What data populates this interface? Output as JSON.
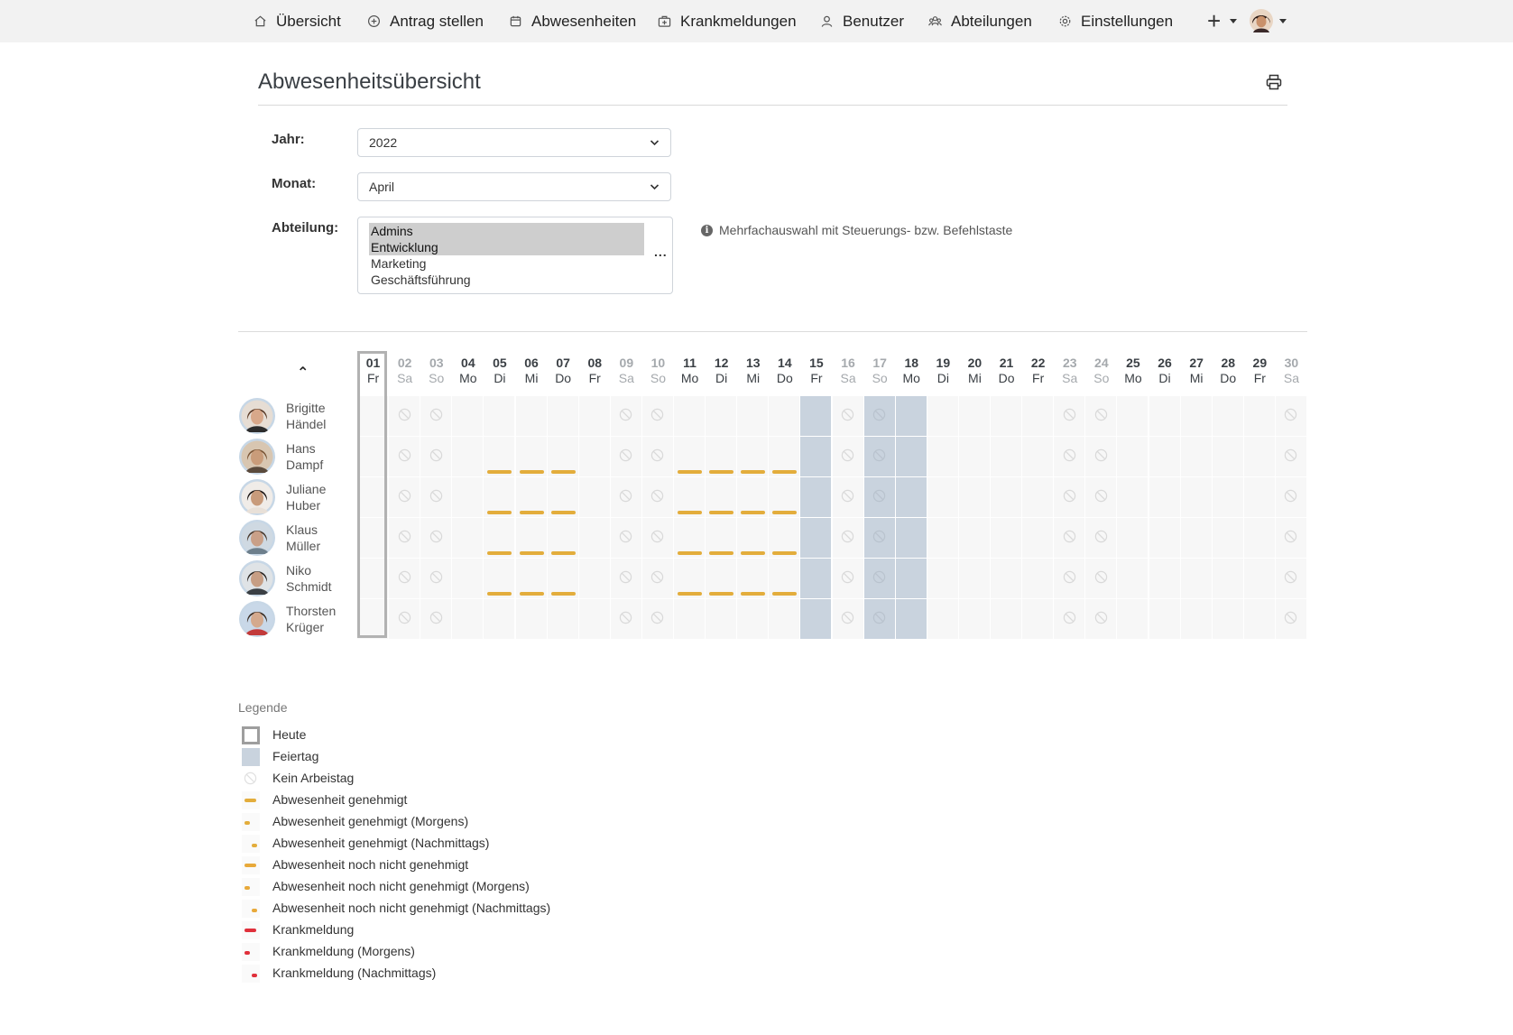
{
  "navbar": {
    "items": [
      {
        "label": "Übersicht",
        "icon": "home-icon"
      },
      {
        "label": "Antrag stellen",
        "icon": "plus-circle-icon"
      },
      {
        "label": "Abwesenheiten",
        "icon": "calendar-icon"
      },
      {
        "label": "Krankmeldungen",
        "icon": "medical-bag-icon"
      },
      {
        "label": "Benutzer",
        "icon": "user-icon"
      },
      {
        "label": "Abteilungen",
        "icon": "users-icon"
      },
      {
        "label": "Einstellungen",
        "icon": "gear-icon"
      }
    ],
    "add_symbol": "+"
  },
  "page": {
    "title": "Abwesenheitsübersicht"
  },
  "filters": {
    "year_label": "Jahr:",
    "year_value": "2022",
    "month_label": "Monat:",
    "month_value": "April",
    "department_label": "Abteilung:",
    "departments": [
      {
        "name": "Admins",
        "selected": true
      },
      {
        "name": "Entwicklung",
        "selected": true
      },
      {
        "name": "Marketing",
        "selected": false
      },
      {
        "name": "Geschäftsführung",
        "selected": false
      }
    ],
    "more_symbol": "...",
    "multi_hint": "Mehrfachauswahl mit Steuerungs- bzw. Befehlstaste"
  },
  "calendar": {
    "sort_symbol": "⌃",
    "today_day": "01",
    "days": [
      {
        "num": "01",
        "wd": "Fr",
        "type": "work"
      },
      {
        "num": "02",
        "wd": "Sa",
        "type": "weekend"
      },
      {
        "num": "03",
        "wd": "So",
        "type": "weekend"
      },
      {
        "num": "04",
        "wd": "Mo",
        "type": "work"
      },
      {
        "num": "05",
        "wd": "Di",
        "type": "work"
      },
      {
        "num": "06",
        "wd": "Mi",
        "type": "work"
      },
      {
        "num": "07",
        "wd": "Do",
        "type": "work"
      },
      {
        "num": "08",
        "wd": "Fr",
        "type": "work"
      },
      {
        "num": "09",
        "wd": "Sa",
        "type": "weekend"
      },
      {
        "num": "10",
        "wd": "So",
        "type": "weekend"
      },
      {
        "num": "11",
        "wd": "Mo",
        "type": "work"
      },
      {
        "num": "12",
        "wd": "Di",
        "type": "work"
      },
      {
        "num": "13",
        "wd": "Mi",
        "type": "work"
      },
      {
        "num": "14",
        "wd": "Do",
        "type": "work"
      },
      {
        "num": "15",
        "wd": "Fr",
        "type": "holiday"
      },
      {
        "num": "16",
        "wd": "Sa",
        "type": "weekend"
      },
      {
        "num": "17",
        "wd": "So",
        "type": "holiday-weekend"
      },
      {
        "num": "18",
        "wd": "Mo",
        "type": "holiday"
      },
      {
        "num": "19",
        "wd": "Di",
        "type": "work"
      },
      {
        "num": "20",
        "wd": "Mi",
        "type": "work"
      },
      {
        "num": "21",
        "wd": "Do",
        "type": "work"
      },
      {
        "num": "22",
        "wd": "Fr",
        "type": "work"
      },
      {
        "num": "23",
        "wd": "Sa",
        "type": "weekend"
      },
      {
        "num": "24",
        "wd": "So",
        "type": "weekend"
      },
      {
        "num": "25",
        "wd": "Mo",
        "type": "work"
      },
      {
        "num": "26",
        "wd": "Di",
        "type": "work"
      },
      {
        "num": "27",
        "wd": "Mi",
        "type": "work"
      },
      {
        "num": "28",
        "wd": "Do",
        "type": "work"
      },
      {
        "num": "29",
        "wd": "Fr",
        "type": "work"
      },
      {
        "num": "30",
        "wd": "Sa",
        "type": "weekend"
      }
    ],
    "people": [
      {
        "first": "Brigitte",
        "last": "Händel",
        "absence_days": []
      },
      {
        "first": "Hans",
        "last": "Dampf",
        "absence_days": [
          5,
          6,
          7,
          11,
          12,
          13,
          14
        ]
      },
      {
        "first": "Juliane",
        "last": "Huber",
        "absence_days": [
          5,
          6,
          7,
          11,
          12,
          13,
          14
        ]
      },
      {
        "first": "Klaus",
        "last": "Müller",
        "absence_days": [
          5,
          6,
          7,
          11,
          12,
          13,
          14
        ]
      },
      {
        "first": "Niko",
        "last": "Schmidt",
        "absence_days": [
          5,
          6,
          7,
          11,
          12,
          13,
          14
        ]
      },
      {
        "first": "Thorsten",
        "last": "Krüger",
        "absence_days": []
      }
    ]
  },
  "legend": {
    "title": "Legende",
    "items": [
      {
        "label": "Heute",
        "kind": "today"
      },
      {
        "label": "Feiertag",
        "kind": "holiday"
      },
      {
        "label": "Kein Arbeistag",
        "kind": "nowork"
      },
      {
        "label": "Abwesenheit genehmigt",
        "kind": "full",
        "color": "#e3ad3c"
      },
      {
        "label": "Abwesenheit genehmigt (Morgens)",
        "kind": "morning",
        "color": "#e3ad3c"
      },
      {
        "label": "Abwesenheit genehmigt (Nachmittags)",
        "kind": "afternoon",
        "color": "#e3ad3c"
      },
      {
        "label": "Abwesenheit noch nicht genehmigt",
        "kind": "full",
        "color": "#e8a93a"
      },
      {
        "label": "Abwesenheit noch nicht genehmigt (Morgens)",
        "kind": "morning",
        "color": "#e8a93a"
      },
      {
        "label": "Abwesenheit noch nicht genehmigt (Nachmittags)",
        "kind": "afternoon",
        "color": "#e8a93a"
      },
      {
        "label": "Krankmeldung",
        "kind": "full",
        "color": "#e0303b"
      },
      {
        "label": "Krankmeldung (Morgens)",
        "kind": "morning",
        "color": "#e0303b"
      },
      {
        "label": "Krankmeldung (Nachmittags)",
        "kind": "afternoon",
        "color": "#e0303b"
      }
    ]
  },
  "colors": {
    "holiday": "#c9d3de",
    "cell": "#f7f7f7",
    "approved": "#e3ad3c",
    "sick": "#e0303b"
  }
}
